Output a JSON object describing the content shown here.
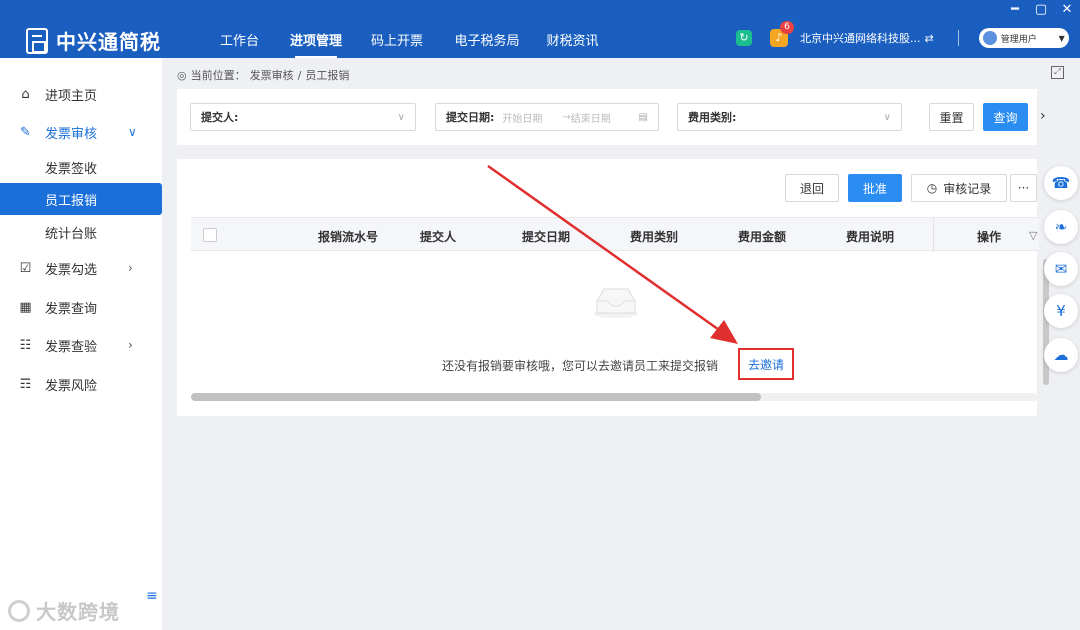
{
  "window_controls": [
    "━",
    "▢",
    "✕"
  ],
  "brand": {
    "name": "中兴通简税"
  },
  "nav": [
    {
      "label": "工作台"
    },
    {
      "label": "进项管理"
    },
    {
      "label": "码上开票"
    },
    {
      "label": "电子税务局"
    },
    {
      "label": "财税资讯"
    }
  ],
  "header": {
    "notification_count": "6",
    "company": "北京中兴通网络科技股...",
    "user": "管理用户"
  },
  "sidebar": {
    "items": [
      {
        "label": "进项主页",
        "icon": "home-icon"
      },
      {
        "label": "发票审核",
        "icon": "edit-icon"
      },
      {
        "label": "发票签收"
      },
      {
        "label": "员工报销"
      },
      {
        "label": "统计台账"
      },
      {
        "label": "发票勾选",
        "icon": "checkbox-icon"
      },
      {
        "label": "发票查询",
        "icon": "grid-icon"
      },
      {
        "label": "发票查验",
        "icon": "inspect-icon"
      },
      {
        "label": "发票风险",
        "icon": "chart-icon"
      }
    ]
  },
  "breadcrumb": {
    "prefix": "当前位置：",
    "parent": "发票审核",
    "sep": "/",
    "current": "员工报销"
  },
  "filters": {
    "submitter_label": "提交人:",
    "date_label": "提交日期:",
    "date_start_placeholder": "开始日期",
    "date_arrow": "→",
    "date_end_placeholder": "结束日期",
    "category_label": "费用类别:",
    "reset": "重置",
    "query": "查询"
  },
  "actions": {
    "return": "退回",
    "approve": "批准",
    "history": "审核记录",
    "more": "···"
  },
  "table": {
    "columns": [
      "报销流水号",
      "提交人",
      "提交日期",
      "费用类别",
      "费用金额",
      "费用说明",
      "操作"
    ]
  },
  "empty_state": {
    "message": "还没有报销要审核哦，您可以去邀请员工来提交报销",
    "link": "去邀请"
  },
  "watermark": "大数跨境",
  "colors": {
    "brand_blue": "#1a5fc0",
    "primary": "#2b8cf2",
    "annotation_red": "#e02f2f"
  }
}
